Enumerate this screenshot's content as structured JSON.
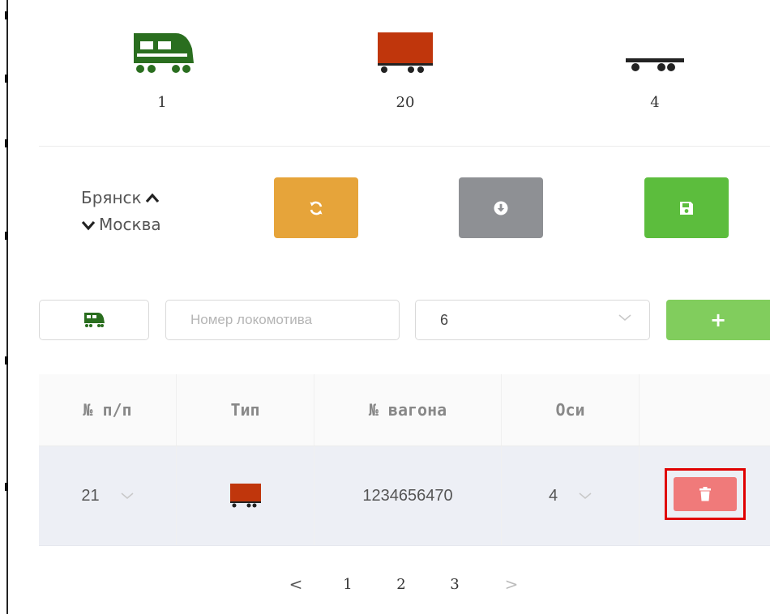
{
  "counters": [
    {
      "icon": "locomotive-icon",
      "count": "1",
      "color": "#2a6e1f"
    },
    {
      "icon": "boxcar-icon",
      "count": "20",
      "color": "#c0360c"
    },
    {
      "icon": "flatcar-icon",
      "count": "4",
      "color": "#222222"
    }
  ],
  "route": {
    "from": "Брянск",
    "to": "Москва"
  },
  "actions": {
    "sync_icon": "refresh-icon",
    "download_icon": "download-circle-icon",
    "save_icon": "floppy-disk-icon",
    "colors": {
      "sync": "#e6a43a",
      "download": "#8e9094",
      "save": "#5cbd3d"
    }
  },
  "form": {
    "type_icon": "locomotive-icon",
    "number_placeholder": "Номер локомотива",
    "axles_value": "6",
    "add_label": "+"
  },
  "table": {
    "headers": [
      "№ п/п",
      "Тип",
      "№ вагона",
      "Оси",
      ""
    ],
    "rows": [
      {
        "index": "21",
        "type_icon": "boxcar-icon",
        "wagon_number": "1234656470",
        "axles": "4",
        "delete_icon": "trash-icon"
      }
    ]
  },
  "pagination": {
    "prev": "<",
    "pages": [
      "1",
      "2",
      "3"
    ],
    "next": ">"
  }
}
